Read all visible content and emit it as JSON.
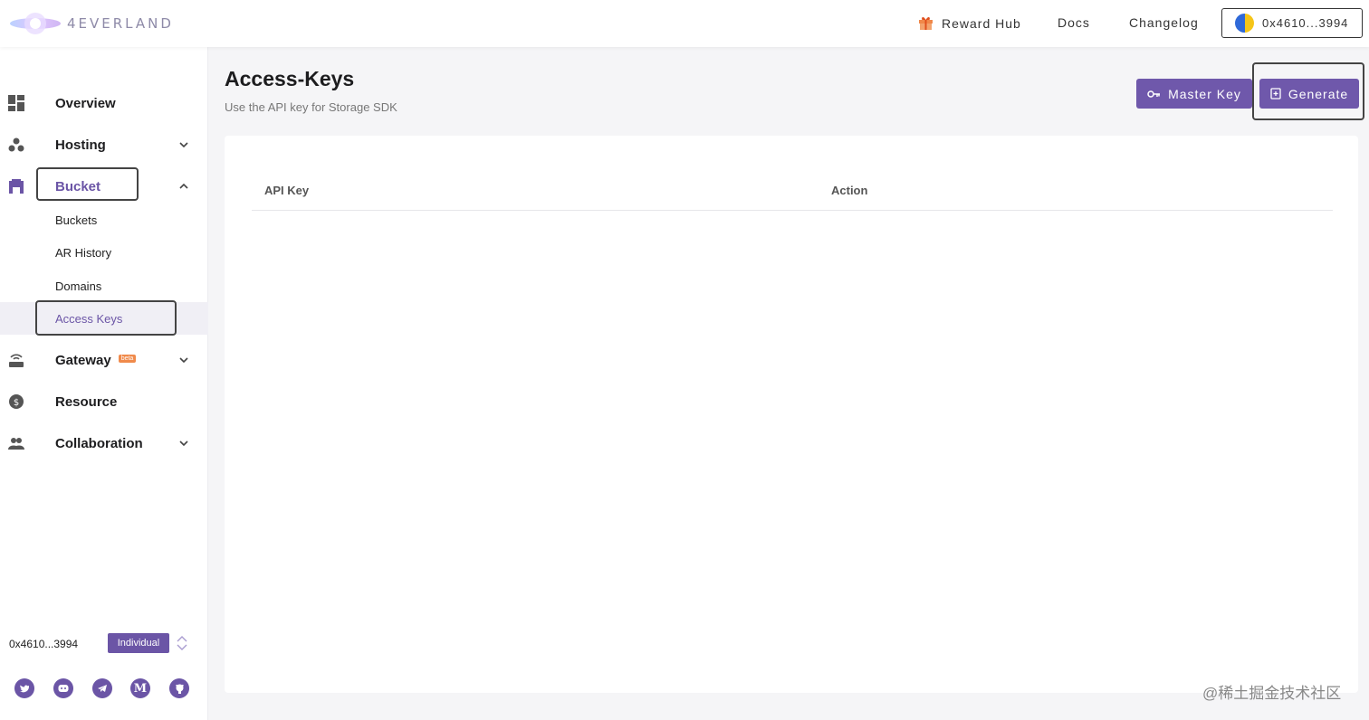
{
  "header": {
    "logo_text": "4EVERLAND",
    "nav": {
      "reward_hub": "Reward Hub",
      "docs": "Docs",
      "changelog": "Changelog"
    },
    "wallet": "0x4610...3994"
  },
  "sidebar": {
    "overview": "Overview",
    "hosting": "Hosting",
    "bucket": "Bucket",
    "bucket_items": {
      "buckets": "Buckets",
      "ar_history": "AR History",
      "domains": "Domains",
      "access_keys": "Access Keys"
    },
    "gateway": "Gateway",
    "gateway_badge": "beta",
    "resource": "Resource",
    "collaboration": "Collaboration",
    "account": {
      "address": "0x4610...3994",
      "type": "Individual"
    },
    "socials": [
      "twitter-icon",
      "discord-icon",
      "telegram-icon",
      "medium-icon",
      "github-icon"
    ]
  },
  "main": {
    "title": "Access-Keys",
    "subtitle": "Use the API key for Storage SDK",
    "buttons": {
      "master_key": "Master Key",
      "generate": "Generate"
    },
    "table": {
      "columns": [
        "API Key",
        "Action"
      ],
      "rows": []
    }
  },
  "watermark": "@稀土掘金技术社区",
  "colors": {
    "accent": "#6f58ab",
    "active_bg": "#f0eff5",
    "beta_badge": "#f08a4b"
  }
}
